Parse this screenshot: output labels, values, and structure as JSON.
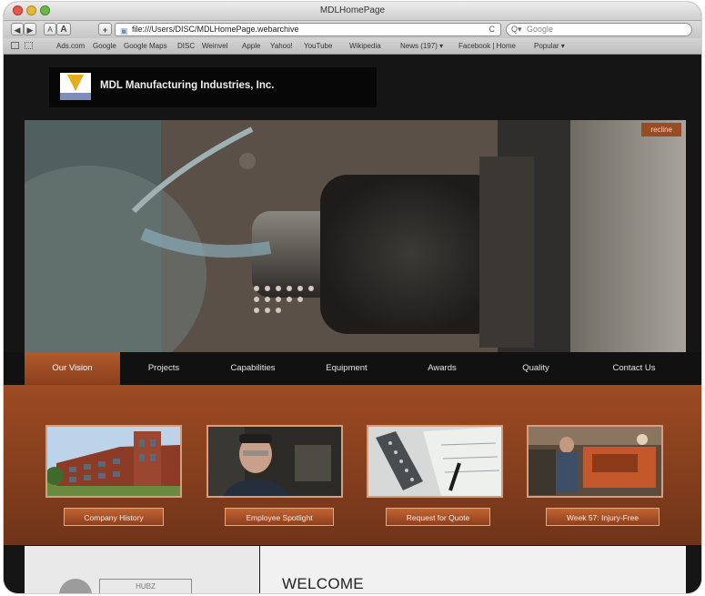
{
  "window": {
    "title": "MDLHomePage",
    "url": "file:///Users/DISC/MDLHomePage.webarchive",
    "search_placeholder": "Google",
    "nav_back": "◀",
    "nav_forward": "▶",
    "font_smaller": "A",
    "font_larger": "A",
    "add_button": "+",
    "reload_icon": "C",
    "bookmarks": [
      "Ads.com",
      "Google",
      "Google Maps",
      "DISC",
      "Weinvel",
      "Apple",
      "Yahoo!",
      "YouTube",
      "Wikipedia",
      "News (197) ▾",
      "Facebook | Home",
      "Popular ▾"
    ]
  },
  "site": {
    "company_name": "MDL Manufacturing Industries, Inc.",
    "hero_tag": "recline",
    "nav": [
      "Our Vision",
      "Projects",
      "Capabilities",
      "Equipment",
      "Awards",
      "Quality",
      "Contact Us"
    ],
    "active_nav": "Our Vision",
    "cards": [
      {
        "label": "Company History",
        "icon": "building-photo"
      },
      {
        "label": "Employee Spotlight",
        "icon": "employee-photo"
      },
      {
        "label": "Request for Quote",
        "icon": "blueprint-photo"
      },
      {
        "label": "Week 57: Injury-Free",
        "icon": "shop-floor-photo"
      }
    ],
    "welcome": "WELCOME",
    "cert_label": "HUBZ"
  },
  "colors": {
    "brand_orange": "#9d4b22",
    "nav_bg": "#111111",
    "logo_bar": "#7d8fb6"
  }
}
